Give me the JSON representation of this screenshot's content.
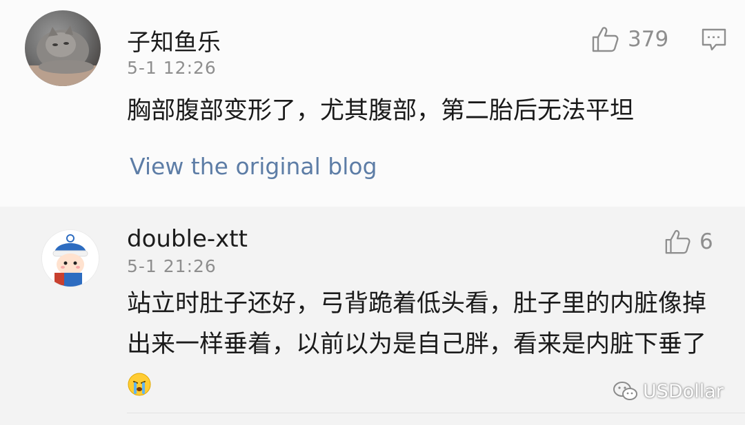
{
  "comments": [
    {
      "username": "子知鱼乐",
      "timestamp": "5-1 12:26",
      "text": "胸部腹部变形了，尤其腹部，第二胎后无法平坦",
      "likes": "379",
      "link_label": "View the original blog"
    },
    {
      "username": "double-xtt",
      "timestamp": "5-1 21:26",
      "text": "站立时肚子还好，弓背跪着低头看，肚子里的内脏像掉出来一样垂着，以前以为是自己胖，看来是内脏下垂了",
      "likes": "6"
    }
  ],
  "watermark": {
    "label": "USDollar"
  },
  "colors": {
    "link": "#5d7da6",
    "meta": "#8e8e8e",
    "first_bg": "#fbfbfb",
    "second_bg": "#f3f3f3"
  },
  "icons": {
    "like": "thumbs-up-icon",
    "reply": "comment-bubble-icon",
    "emoji": "crying-face-emoji",
    "watermark": "wechat-icon"
  }
}
